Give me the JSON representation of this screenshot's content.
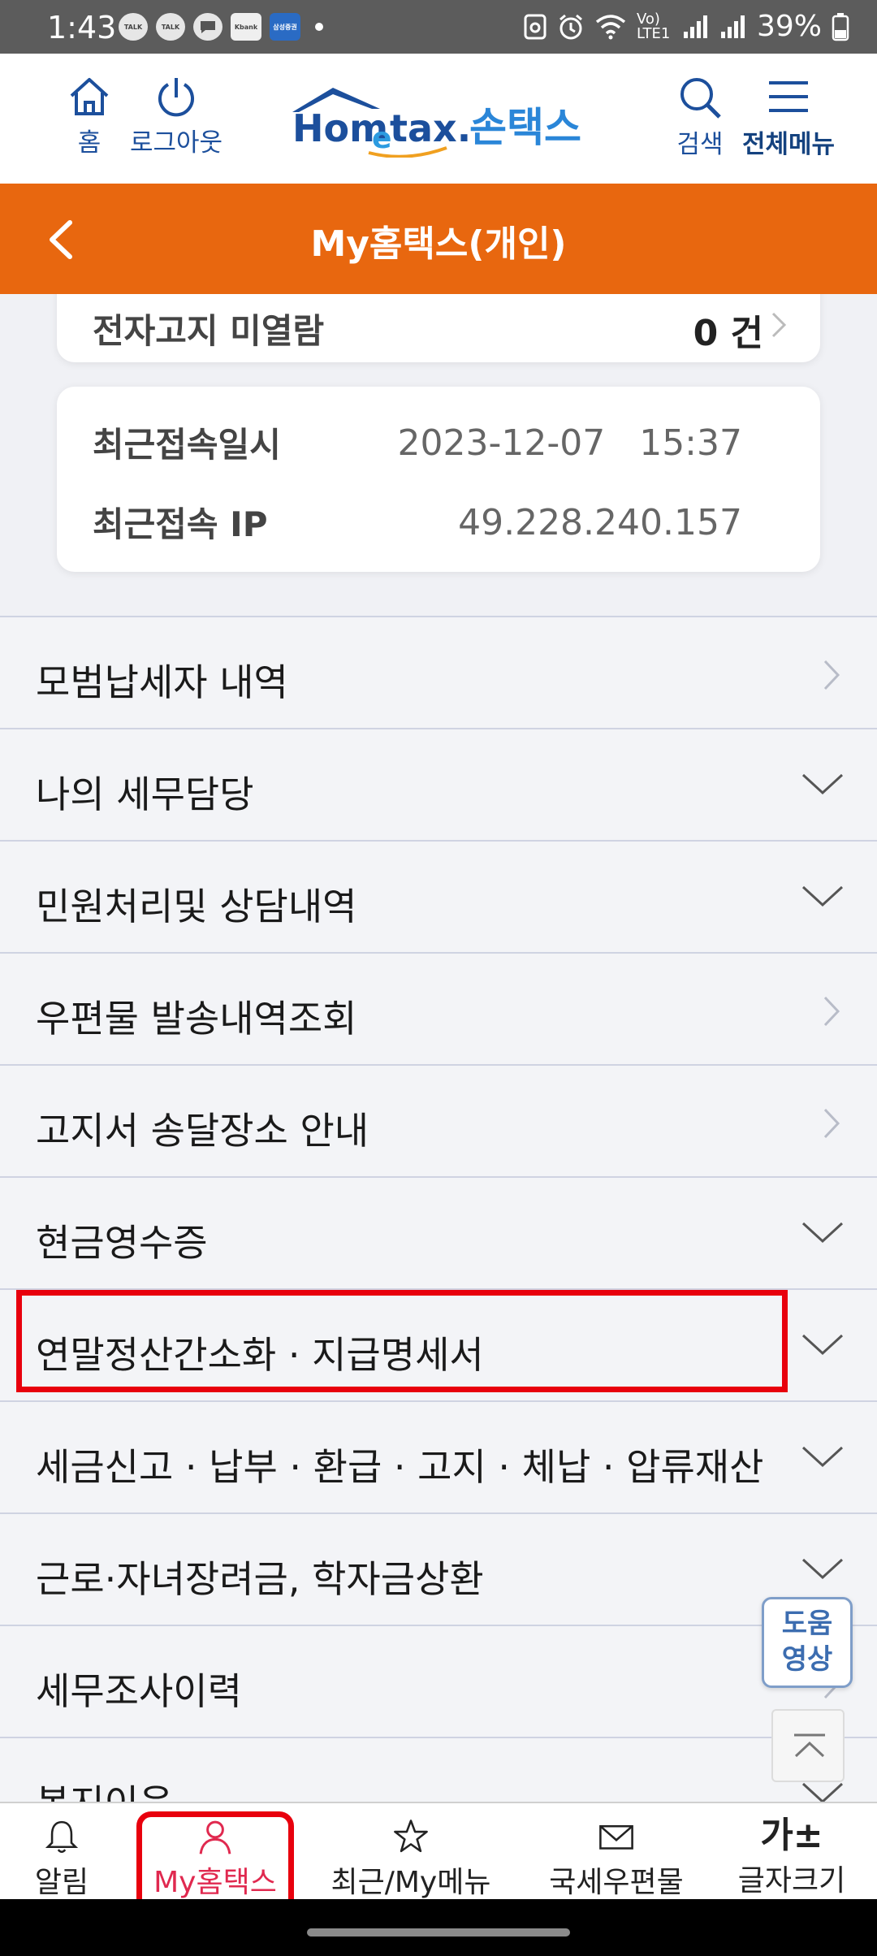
{
  "status_bar": {
    "time": "1:43",
    "battery": "39%",
    "notifications": [
      "TALK",
      "TALK",
      "message",
      "Kbank",
      "삼성증권"
    ],
    "network": "Vo) LTE1"
  },
  "header": {
    "home_label": "홈",
    "logout_label": "로그아웃",
    "logo_text_main": "Hometax.",
    "logo_text_kor": "손택스",
    "search_label": "검색",
    "menu_label": "전체메뉴"
  },
  "title_bar": {
    "title": "My홈택스(개인)"
  },
  "notice_card": {
    "label": "전자고지 미열람",
    "value": "0 건"
  },
  "access_card": {
    "last_access_label": "최근접속일시",
    "last_access_value": "2023-12-07   15:37",
    "last_ip_label": "최근접속 IP",
    "last_ip_value": "49.228.240.157"
  },
  "menu_items": [
    {
      "label": "모범납세자 내역",
      "icon": "chevron-right-icon"
    },
    {
      "label": "나의 세무담당",
      "icon": "chevron-down-icon"
    },
    {
      "label": "민원처리및 상담내역",
      "icon": "chevron-down-icon"
    },
    {
      "label": "우편물 발송내역조회",
      "icon": "chevron-right-icon"
    },
    {
      "label": "고지서 송달장소 안내",
      "icon": "chevron-right-icon"
    },
    {
      "label": "현금영수증",
      "icon": "chevron-down-icon"
    },
    {
      "label": "연말정산간소화 · 지급명세서",
      "icon": "chevron-down-icon"
    },
    {
      "label": "세금신고 · 납부 · 환급 · 고지 · 체납 · 압류재산",
      "icon": "chevron-down-icon"
    },
    {
      "label": "근로·자녀장려금, 학자금상환",
      "icon": "chevron-down-icon"
    },
    {
      "label": "세무조사이력",
      "icon": "chevron-right-icon"
    },
    {
      "label": "복지이음",
      "icon": "chevron-down-icon"
    }
  ],
  "help_button": {
    "line1": "도움",
    "line2": "영상"
  },
  "bottom_nav": {
    "alarm": "알림",
    "my_hometax": "My홈택스",
    "recent": "최근/My메뉴",
    "mail": "국세우편물",
    "font_size": "글자크기",
    "font_glyph": "가±"
  },
  "colors": {
    "accent_orange": "#e8670f",
    "brand_blue": "#1c4f9c",
    "active_pink": "#e0294f",
    "highlight_red": "#e8000d"
  }
}
